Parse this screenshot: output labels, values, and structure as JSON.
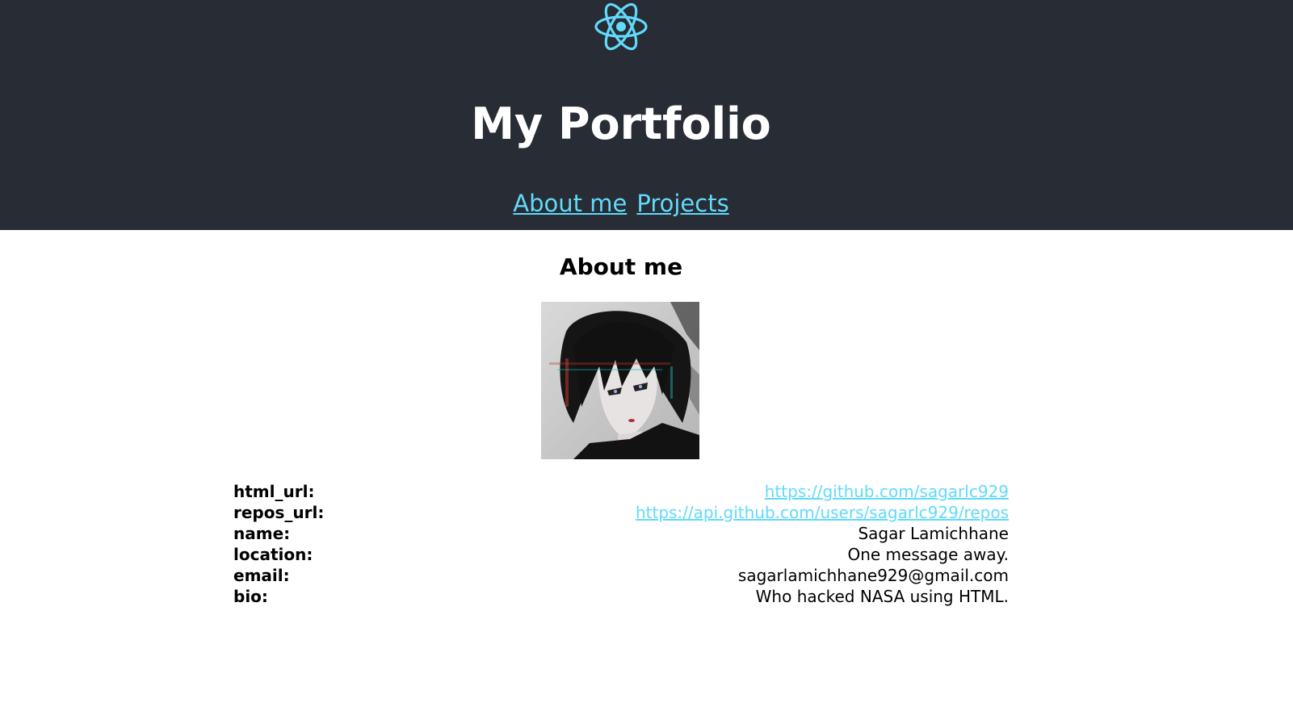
{
  "header": {
    "logo_icon": "react-atom-icon",
    "title": "My Portfolio",
    "background": "#282c34",
    "accent": "#61dafb",
    "nav": [
      {
        "label": "About me"
      },
      {
        "label": "Projects"
      }
    ]
  },
  "about": {
    "heading": "About me",
    "rows": [
      {
        "key": "html_url:",
        "value": "https://github.com/sagarlc929",
        "link": true
      },
      {
        "key": "repos_url:",
        "value": "https://api.github.com/users/sagarlc929/repos",
        "link": true
      },
      {
        "key": "name:",
        "value": "Sagar Lamichhane",
        "link": false
      },
      {
        "key": "location:",
        "value": "One message away.",
        "link": false
      },
      {
        "key": "email:",
        "value": "sagarlamichhane929@gmail.com",
        "link": false
      },
      {
        "key": "bio:",
        "value": "Who hacked NASA using HTML.",
        "link": false
      }
    ]
  }
}
